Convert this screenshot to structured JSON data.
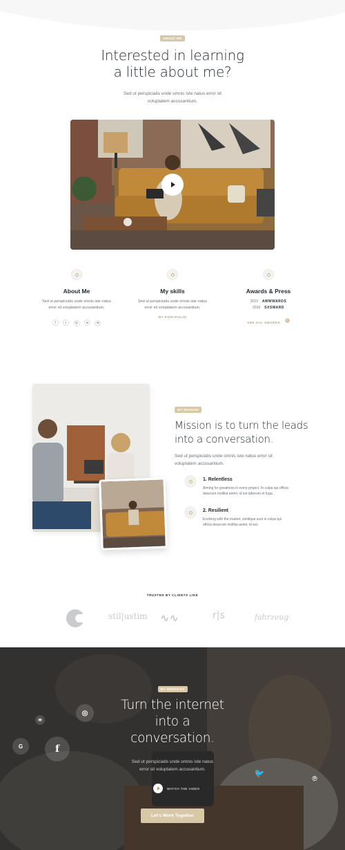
{
  "about": {
    "badge": "ABOUT ME",
    "title_line1": "Interested in learning",
    "title_line2": "a little about me?",
    "subtitle_line1": "Sed ut perspiciatis unde omnis iste natus error sit",
    "subtitle_line2": "voluptatem accusantium."
  },
  "features": [
    {
      "title": "About Me",
      "text_line1": "Sed ut perspiciatis unde omnis iste natus",
      "text_line2": "error sit voluptatem accusantium."
    },
    {
      "title": "My skills",
      "text_line1": "Sed ut perspiciatis unde omnis iste natus",
      "text_line2": "error sit voluptatem accusantium.",
      "link": "MY PORTFOLIO"
    },
    {
      "title": "Awards & Press",
      "awards": [
        {
          "year": "2010",
          "name": "AWWWARDS"
        },
        {
          "year": "2019",
          "name": "SXSWARD"
        }
      ],
      "link": "SEE ALL AWARDS"
    }
  ],
  "social_small": [
    "f",
    "t",
    "◎",
    "in",
    "⊚"
  ],
  "mission": {
    "badge": "MY MISSION",
    "title_line1": "Mission is to turn the leads",
    "title_line2": "into a conversation.",
    "text_line1": "Sed ut perspiciatis unde omnis iste natus error sit",
    "text_line2": "voluptatem accusantium.",
    "steps": [
      {
        "title": "1. Relentless",
        "text_line1": "Aiming for greatness in every project. In culpa qui officia",
        "text_line2": "deserunt mollitia animi, id est laborum et fuga."
      },
      {
        "title": "2. Resilient",
        "text_line1": "Evolving with the market, similique sunt in culpa qui",
        "text_line2": "officia deserunt mollitia animi, id est."
      }
    ]
  },
  "clients": {
    "heading": "TRUSTED BY CLIENTS LIKE",
    "logos": [
      "C",
      "stil|ustim",
      "∿∿",
      "r|s",
      "fahrzeug"
    ]
  },
  "services": {
    "badge": "MY SERVICES",
    "title_line1": "Turn the internet",
    "title_line2": "into a",
    "title_line3": "conversation.",
    "text_line1": "Sed ut perspiciatis unde omnis iste natus",
    "text_line2": "error sit voluptatem accusantium.",
    "watch": "WATCH THE VIDEO",
    "cta": "Let's Work Together"
  },
  "colors": {
    "accent": "#d8c8a8",
    "dark_overlay": "#3b3b3b"
  }
}
